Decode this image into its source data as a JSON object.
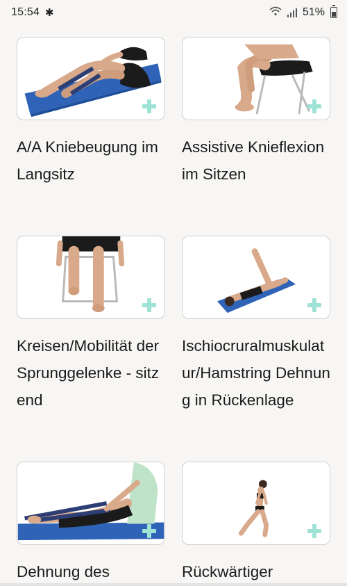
{
  "status_bar": {
    "time": "15:54",
    "bluetooth_icon": "bluetooth-icon",
    "wifi_icon": "wifi-icon",
    "signal_icon": "signal-icon",
    "battery_percent": "51%",
    "battery_icon": "battery-icon"
  },
  "exercises": [
    {
      "title": "A/A Kniebeugung im Langsitz",
      "image": "person-seated-on-mat-with-band",
      "add_icon": "plus-icon"
    },
    {
      "title": "Assistive Knieflexion im Sitzen",
      "image": "person-on-chair-knee-flexion",
      "add_icon": "plus-icon"
    },
    {
      "title": "Kreisen/Mobilität der Sprunggelenke - sitzend",
      "image": "legs-on-chair-ankle-circles",
      "add_icon": "plus-icon"
    },
    {
      "title": "Ischiocruralmuskulatur/Hamstring Dehnung in Rückenlage",
      "image": "person-lying-leg-raised",
      "add_icon": "plus-icon"
    },
    {
      "title": "Dehnung des",
      "image": "person-seated-with-band-stretch",
      "add_icon": "plus-icon"
    },
    {
      "title": "Rückwärtiger",
      "image": "person-standing-lunge",
      "add_icon": "plus-icon"
    }
  ],
  "colors": {
    "background": "#f7f6f4",
    "card_border": "#cfcfcf",
    "plus_accent": "#9fe3d6",
    "mat_blue": "#2e63b8"
  }
}
